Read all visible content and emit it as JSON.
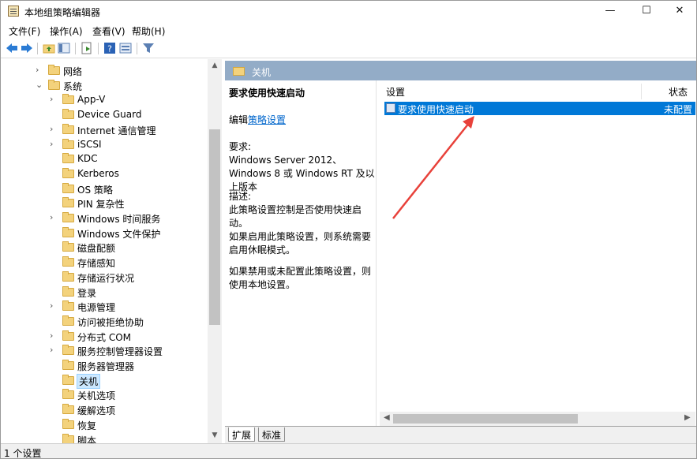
{
  "window": {
    "title": "本地组策略编辑器",
    "minimize": "—",
    "maximize": "☐",
    "close": "✕"
  },
  "menu": [
    {
      "label": "文件(F)"
    },
    {
      "label": "操作(A)"
    },
    {
      "label": "查看(V)"
    },
    {
      "label": "帮助(H)"
    }
  ],
  "tree": {
    "items": [
      {
        "label": "网络",
        "chev": "›"
      },
      {
        "label": "系统",
        "chev": "⌄"
      },
      {
        "label": "App-V",
        "chev": "›"
      },
      {
        "label": "Device Guard",
        "chev": ""
      },
      {
        "label": "Internet 通信管理",
        "chev": "›"
      },
      {
        "label": "iSCSI",
        "chev": "›"
      },
      {
        "label": "KDC",
        "chev": ""
      },
      {
        "label": "Kerberos",
        "chev": ""
      },
      {
        "label": "OS 策略",
        "chev": ""
      },
      {
        "label": "PIN 复杂性",
        "chev": ""
      },
      {
        "label": "Windows 时间服务",
        "chev": "›"
      },
      {
        "label": "Windows 文件保护",
        "chev": ""
      },
      {
        "label": "磁盘配额",
        "chev": ""
      },
      {
        "label": "存储感知",
        "chev": ""
      },
      {
        "label": "存储运行状况",
        "chev": ""
      },
      {
        "label": "登录",
        "chev": ""
      },
      {
        "label": "电源管理",
        "chev": "›"
      },
      {
        "label": "访问被拒绝协助",
        "chev": ""
      },
      {
        "label": "分布式 COM",
        "chev": "›"
      },
      {
        "label": "服务控制管理器设置",
        "chev": "›"
      },
      {
        "label": "服务器管理器",
        "chev": ""
      },
      {
        "label": "关机",
        "chev": "",
        "selected": true
      },
      {
        "label": "关机选项",
        "chev": ""
      },
      {
        "label": "缓解选项",
        "chev": ""
      },
      {
        "label": "恢复",
        "chev": ""
      },
      {
        "label": "脚本",
        "chev": ""
      }
    ]
  },
  "right": {
    "header_title": "关机",
    "desc": {
      "heading": "要求使用快速启动",
      "edit_prefix": "编辑",
      "edit_link": "策略设置",
      "requirements_label": "要求:",
      "requirements": "Windows Server 2012、Windows 8 或 Windows RT 及以上版本",
      "description_label": "描述:",
      "description": "此策略设置控制是否使用快速启动。",
      "enabled_text": "如果启用此策略设置，则系统需要启用休眠模式。",
      "disabled_text": "如果禁用或未配置此策略设置，则使用本地设置。"
    },
    "list": {
      "col_setting": "设置",
      "col_state": "状态",
      "rows": [
        {
          "name": "要求使用快速启动",
          "state": "未配置"
        }
      ]
    },
    "tabs": [
      {
        "label": "扩展"
      },
      {
        "label": "标准"
      }
    ]
  },
  "status": {
    "text": "1 个设置"
  },
  "colors": {
    "selection": "#0078d7",
    "header": "#93acc7",
    "annotation_arrow": "#e8413a"
  }
}
